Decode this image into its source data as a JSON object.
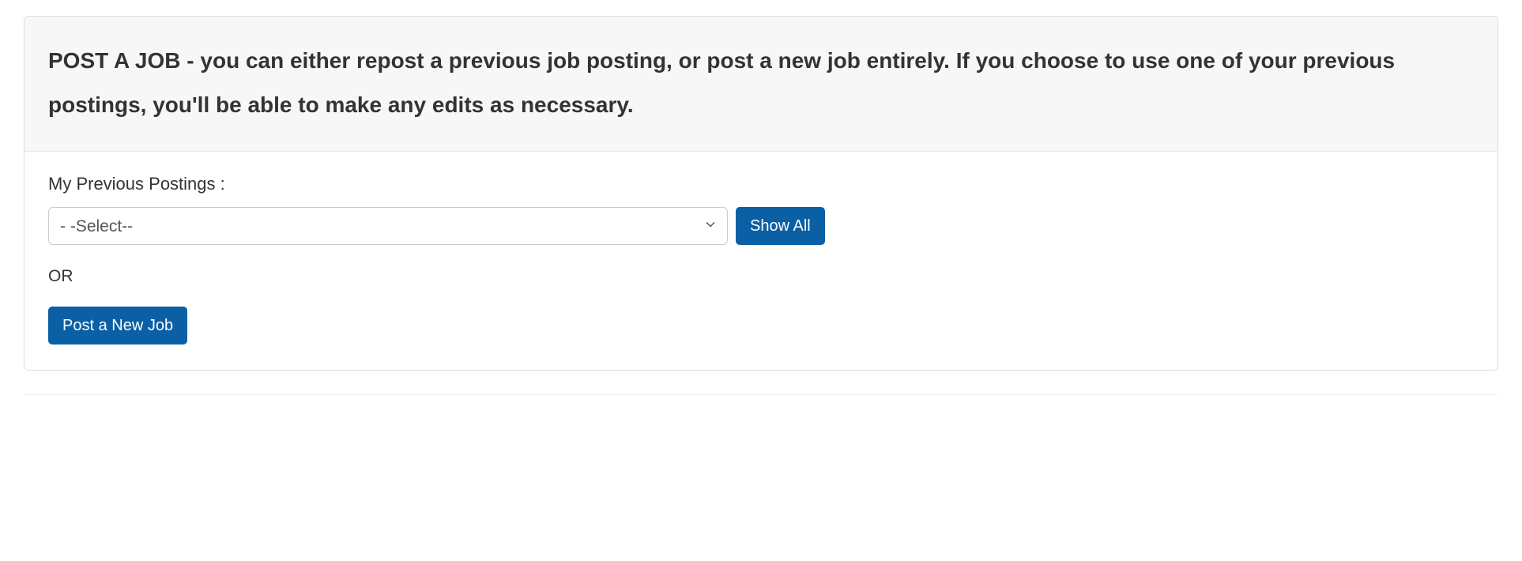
{
  "header": {
    "title": "POST A JOB - you can either repost a previous job posting, or post a new job entirely. If you choose to use one of your previous postings, you'll be able to make any edits as necessary."
  },
  "form": {
    "previous_label": "My Previous Postings :",
    "select_placeholder": "- -Select--",
    "show_all_label": "Show All",
    "or_label": "OR",
    "post_new_label": "Post a New Job"
  }
}
